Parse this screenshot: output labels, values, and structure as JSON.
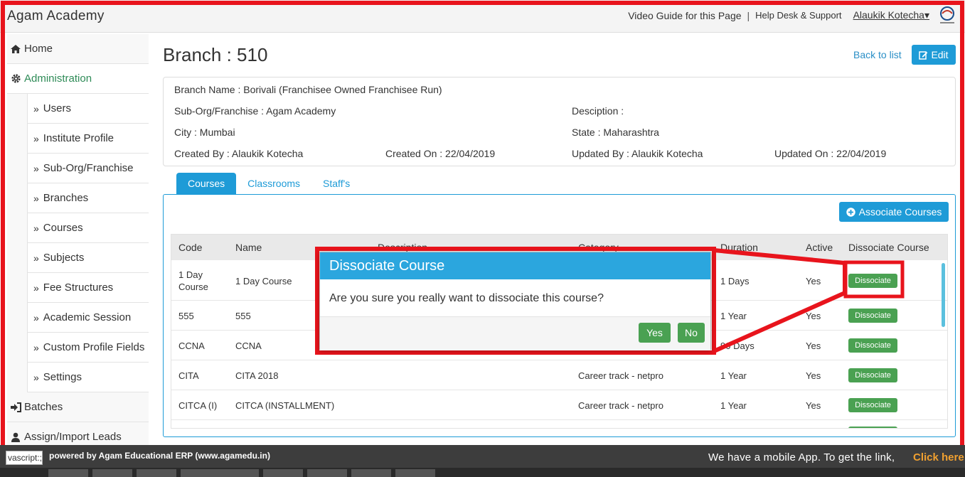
{
  "header": {
    "brand": "Agam Academy",
    "video_guide": "Video Guide for this Page",
    "separator": "|",
    "help_desk": "Help Desk & Support",
    "user": "Alaukik Kotecha",
    "user_caret": "▾"
  },
  "sidebar": {
    "home": "Home",
    "administration": "Administration",
    "sub_items": [
      "Users",
      "Institute Profile",
      "Sub-Org/Franchise",
      "Branches",
      "Courses",
      "Subjects",
      "Fee Structures",
      "Academic Session",
      "Custom Profile Fields",
      "Settings"
    ],
    "batches": "Batches",
    "leads": "Assign/Import Leads"
  },
  "page": {
    "title": "Branch : 510",
    "back_link": "Back to list",
    "edit_label": "Edit"
  },
  "branch": {
    "name": "Branch Name : Borivali (Franchisee Owned Franchisee Run)",
    "suborg": "Sub-Org/Franchise : Agam Academy",
    "description": "Desciption :",
    "city": "City : Mumbai",
    "state": "State : Maharashtra",
    "created_by": "Created By : Alaukik Kotecha",
    "created_on": "Created On : 22/04/2019",
    "updated_by": "Updated By : Alaukik Kotecha",
    "updated_on": "Updated On : 22/04/2019"
  },
  "tabs": [
    "Courses",
    "Classrooms",
    "Staff's"
  ],
  "associate_label": "Associate Courses",
  "table": {
    "headers": [
      "Code",
      "Name",
      "Description",
      "Category",
      "Duration",
      "Active",
      "Dissociate Course"
    ],
    "rows": [
      {
        "code": "1 Day Course",
        "name": "1 Day Course",
        "category": "",
        "duration": "1 Days",
        "active": "Yes"
      },
      {
        "code": "555",
        "name": "555",
        "category": "",
        "duration": "1 Year",
        "active": "Yes"
      },
      {
        "code": "CCNA",
        "name": "CCNA",
        "category": "",
        "duration": "90 Days",
        "active": "Yes"
      },
      {
        "code": "CITA",
        "name": "CITA 2018",
        "category": "Career track - netpro",
        "duration": "1 Year",
        "active": "Yes"
      },
      {
        "code": "CITCA (I)",
        "name": "CITCA (INSTALLMENT)",
        "category": "Career track - netpro",
        "duration": "1 Year",
        "active": "Yes"
      }
    ],
    "button_label": "Dissociate"
  },
  "dialog": {
    "title": "Dissociate Course",
    "message": "Are you sure you really want to dissociate this course?",
    "yes": "Yes",
    "no": "No"
  },
  "footer": {
    "powered": "powered by Agam Educational ERP (www.agamedu.in)",
    "mobile": "We have a mobile App. To get the link,",
    "click": "Click here",
    "js_tip": "vascript:;"
  },
  "colors": {
    "accent": "#1e9bd7",
    "success": "#4aa152",
    "annotation": "#e8141c",
    "active_nav": "#2e8b57"
  }
}
